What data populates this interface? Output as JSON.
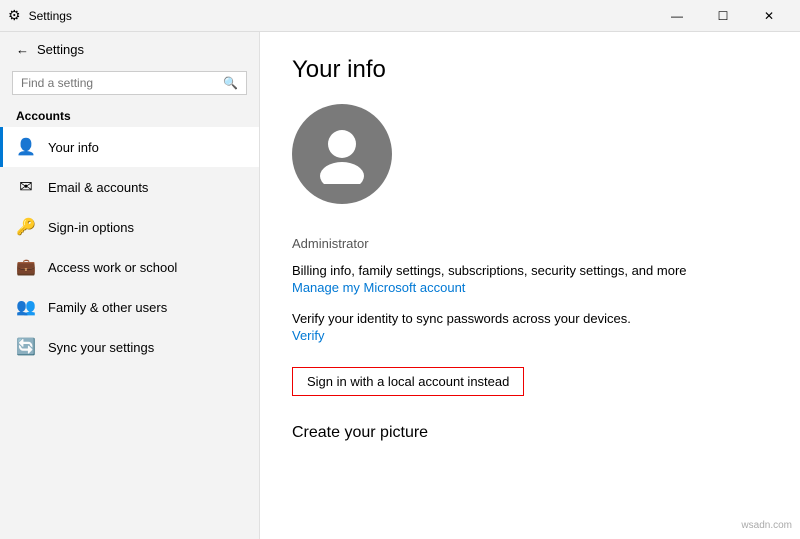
{
  "titlebar": {
    "title": "Settings",
    "minimize": "—",
    "maximize": "☐",
    "close": "✕"
  },
  "sidebar": {
    "back_icon": "←",
    "search_placeholder": "Find a setting",
    "search_icon": "🔍",
    "section_label": "Accounts",
    "items": [
      {
        "id": "your-info",
        "label": "Your info",
        "icon": "👤",
        "active": true
      },
      {
        "id": "email-accounts",
        "label": "Email & accounts",
        "icon": "✉",
        "active": false
      },
      {
        "id": "sign-in-options",
        "label": "Sign-in options",
        "icon": "🔑",
        "active": false
      },
      {
        "id": "access-work",
        "label": "Access work or school",
        "icon": "💼",
        "active": false
      },
      {
        "id": "family-users",
        "label": "Family & other users",
        "icon": "👥",
        "active": false
      },
      {
        "id": "sync-settings",
        "label": "Sync your settings",
        "icon": "🔄",
        "active": false
      }
    ]
  },
  "main": {
    "page_title": "Your info",
    "user_type": "Administrator",
    "billing_info_text": "Billing info, family settings, subscriptions, security settings, and more",
    "manage_account_link": "Manage my Microsoft account",
    "verify_text": "Verify your identity to sync passwords across your devices.",
    "verify_link": "Verify",
    "local_account_btn": "Sign in with a local account instead",
    "create_picture_heading": "Create your picture"
  },
  "watermark": "wsadn.com"
}
